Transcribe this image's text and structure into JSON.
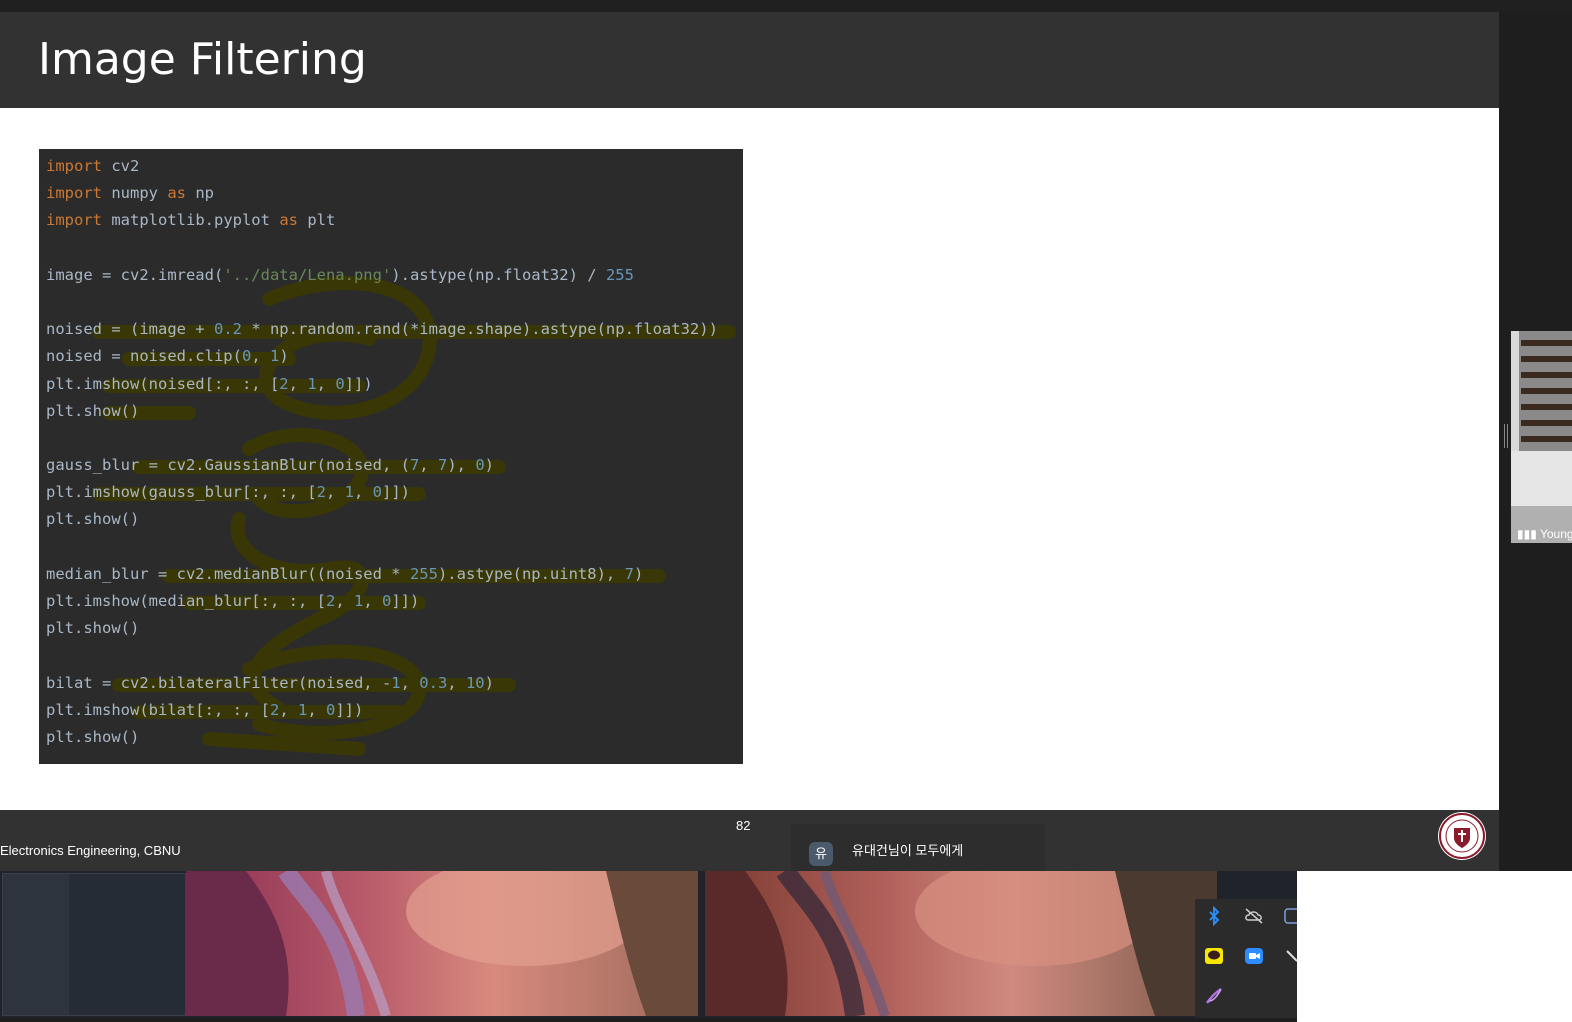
{
  "slide": {
    "title": "Image Filtering",
    "page_number": "82",
    "footer_text": "Electronics Engineering, CBNU",
    "code_lines": [
      [
        {
          "t": "import",
          "c": "kw"
        },
        {
          "t": " cv2"
        }
      ],
      [
        {
          "t": "import",
          "c": "kw"
        },
        {
          "t": " numpy "
        },
        {
          "t": "as",
          "c": "kw"
        },
        {
          "t": " np"
        }
      ],
      [
        {
          "t": "import",
          "c": "kw"
        },
        {
          "t": " matplotlib.pyplot "
        },
        {
          "t": "as",
          "c": "kw"
        },
        {
          "t": " plt"
        }
      ],
      [],
      [
        {
          "t": "image = cv2.imread("
        },
        {
          "t": "'../data/Lena.png'",
          "c": "str"
        },
        {
          "t": ").astype(np.float32) / "
        },
        {
          "t": "255",
          "c": "num"
        }
      ],
      [],
      [
        {
          "t": "noised = (image + "
        },
        {
          "t": "0.2",
          "c": "num"
        },
        {
          "t": " * np.random.rand(*image.shape).astype(np.float32))"
        }
      ],
      [
        {
          "t": "noised = noised.clip("
        },
        {
          "t": "0",
          "c": "num"
        },
        {
          "t": ", "
        },
        {
          "t": "1",
          "c": "num"
        },
        {
          "t": ")"
        }
      ],
      [
        {
          "t": "plt.imshow(noised[:, :, ["
        },
        {
          "t": "2",
          "c": "num"
        },
        {
          "t": ", "
        },
        {
          "t": "1",
          "c": "num"
        },
        {
          "t": ", "
        },
        {
          "t": "0",
          "c": "num"
        },
        {
          "t": "]])"
        }
      ],
      [
        {
          "t": "plt.show()"
        }
      ],
      [],
      [
        {
          "t": "gauss_blur = cv2.GaussianBlur(noised, ("
        },
        {
          "t": "7",
          "c": "num"
        },
        {
          "t": ", "
        },
        {
          "t": "7",
          "c": "num"
        },
        {
          "t": "), "
        },
        {
          "t": "0",
          "c": "num"
        },
        {
          "t": ")"
        }
      ],
      [
        {
          "t": "plt.imshow(gauss_blur[:, :, ["
        },
        {
          "t": "2",
          "c": "num"
        },
        {
          "t": ", "
        },
        {
          "t": "1",
          "c": "num"
        },
        {
          "t": ", "
        },
        {
          "t": "0",
          "c": "num"
        },
        {
          "t": "]])"
        }
      ],
      [
        {
          "t": "plt.show()"
        }
      ],
      [],
      [
        {
          "t": "median_blur = cv2.medianBlur((noised * "
        },
        {
          "t": "255",
          "c": "num"
        },
        {
          "t": ").astype(np.uint8), "
        },
        {
          "t": "7",
          "c": "num"
        },
        {
          "t": ")"
        }
      ],
      [
        {
          "t": "plt.imshow(median_blur[:, :, ["
        },
        {
          "t": "2",
          "c": "num"
        },
        {
          "t": ", "
        },
        {
          "t": "1",
          "c": "num"
        },
        {
          "t": ", "
        },
        {
          "t": "0",
          "c": "num"
        },
        {
          "t": "]])"
        }
      ],
      [
        {
          "t": "plt.show()"
        }
      ],
      [],
      [
        {
          "t": "bilat = cv2.bilateralFilter(noised, -"
        },
        {
          "t": "1",
          "c": "num"
        },
        {
          "t": ", "
        },
        {
          "t": "0.3",
          "c": "num"
        },
        {
          "t": ", "
        },
        {
          "t": "10",
          "c": "num"
        },
        {
          "t": ")"
        }
      ],
      [
        {
          "t": "plt.imshow(bilat[:, :, ["
        },
        {
          "t": "2",
          "c": "num"
        },
        {
          "t": ", "
        },
        {
          "t": "1",
          "c": "num"
        },
        {
          "t": ", "
        },
        {
          "t": "0",
          "c": "num"
        },
        {
          "t": "]])"
        }
      ],
      [
        {
          "t": "plt.show()"
        }
      ]
    ]
  },
  "chat": {
    "avatar_text": "유",
    "message": "유대건님이 모두에게"
  },
  "video": {
    "participant_label": "Young"
  },
  "tray": {
    "icons": [
      "bluetooth-icon",
      "cloud-off-icon",
      "app-icon",
      "kakaotalk-icon",
      "zoom-icon",
      "pen-icon",
      "feather-icon"
    ]
  },
  "colors": {
    "slide_header": "#323232",
    "code_bg": "#2b2b2b",
    "keyword": "#cc7832",
    "string": "#6a8759",
    "number": "#6897bb",
    "annotation_ink": "#3d3a00"
  }
}
